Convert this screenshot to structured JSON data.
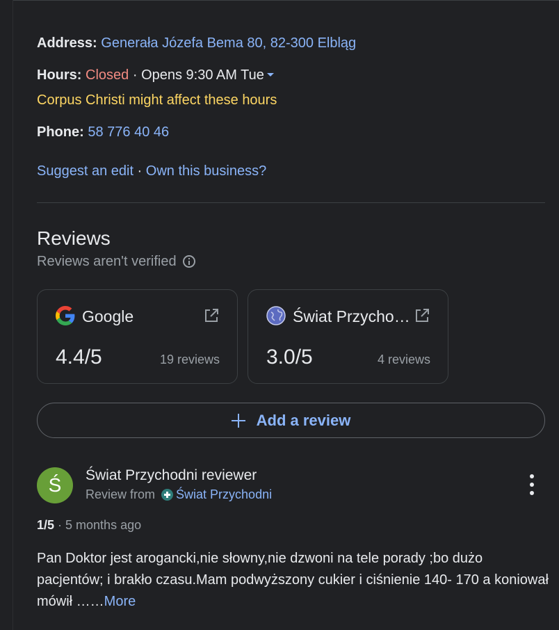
{
  "business": {
    "address_label": "Address:",
    "address_value": "Generała Józefa Bema 80, 82-300 Elbląg",
    "hours_label": "Hours:",
    "hours_status": "Closed",
    "hours_separator": " · ",
    "hours_next": "Opens 9:30 AM Tue",
    "hours_notice": "Corpus Christi might affect these hours",
    "phone_label": "Phone:",
    "phone_value": "58 776 40 46",
    "suggest_edit": "Suggest an edit",
    "link_separator": " · ",
    "own_business": "Own this business?"
  },
  "reviews": {
    "title": "Reviews",
    "subtitle": "Reviews aren't verified",
    "sources": [
      {
        "name": "Google",
        "score": "4.4/5",
        "count": "19 reviews",
        "icon": "google-logo-icon"
      },
      {
        "name": "Świat Przycho…",
        "score": "3.0/5",
        "count": "4 reviews",
        "icon": "globe-icon"
      }
    ],
    "add_review_label": "Add a review"
  },
  "review": {
    "avatar_letter": "Ś",
    "avatar_color": "#689f38",
    "author": "Świat Przychodni reviewer",
    "from_label": "Review from",
    "from_source": "Świat Przychodni",
    "rating": "1/5",
    "meta_separator": " · ",
    "age": "5 months ago",
    "text": "Pan Doktor jest arogancki,nie słowny,nie dzwoni na tele porady ;bo dużo pacjentów; i brakło czasu.Mam podwyższony cukier i ciśnienie 140- 170 a koniował mówił ……",
    "more_label": "More"
  },
  "colors": {
    "background": "#202124",
    "link": "#8ab4f8",
    "closed": "#f28b82",
    "notice": "#fdd663",
    "muted": "#9aa0a6"
  }
}
